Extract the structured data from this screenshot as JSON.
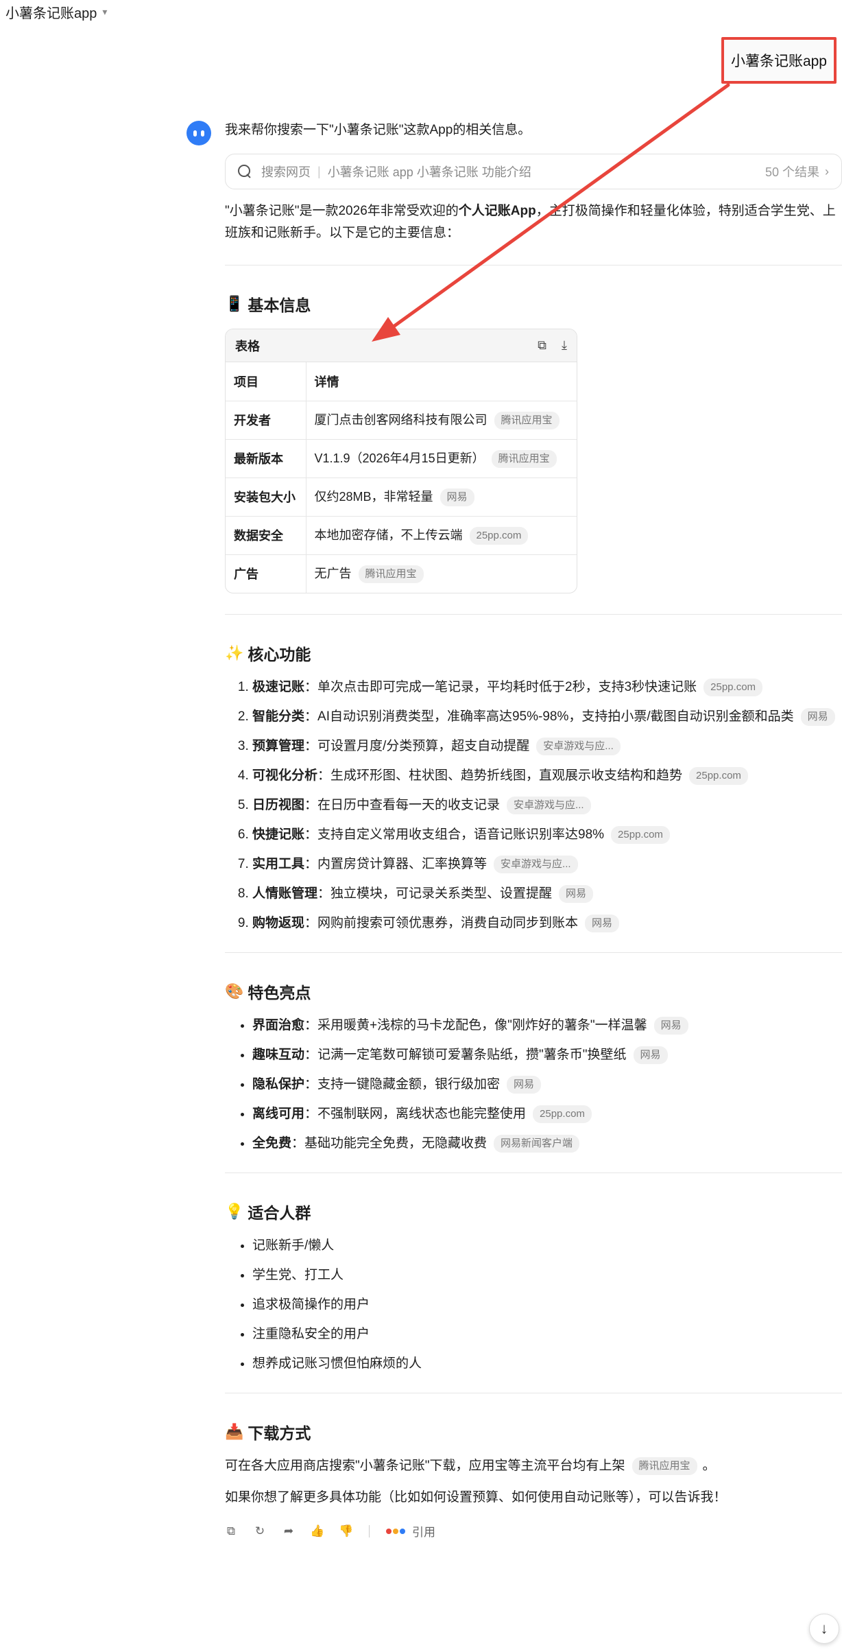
{
  "header": {
    "title": "小薯条记账app"
  },
  "user_message": "小薯条记账app",
  "bot": {
    "intro": "我来帮你搜索一下\"小薯条记账\"这款App的相关信息。",
    "search": {
      "label": "搜索网页",
      "query": "小薯条记账 app 小薯条记账 功能介绍",
      "count": "50 个结果"
    },
    "summary_prefix": "\"小薯条记账\"是一款2026年非常受欢迎的",
    "summary_bold": "个人记账App",
    "summary_suffix": "，主打极简操作和轻量化体验，特别适合学生党、上班族和记账新手。以下是它的主要信息："
  },
  "basic": {
    "icon": "📱",
    "heading": "基本信息",
    "table_label": "表格",
    "col1": "项目",
    "col2": "详情",
    "rows": [
      {
        "k": "开发者",
        "v": "厦门点击创客网络科技有限公司",
        "src": "腾讯应用宝"
      },
      {
        "k": "最新版本",
        "v": "V1.1.9（2026年4月15日更新）",
        "src": "腾讯应用宝"
      },
      {
        "k": "安装包大小",
        "v": "仅约28MB，非常轻量",
        "src": "网易"
      },
      {
        "k": "数据安全",
        "v": "本地加密存储，不上传云端",
        "src": "25pp.com"
      },
      {
        "k": "广告",
        "v": "无广告",
        "src": "腾讯应用宝"
      }
    ]
  },
  "core": {
    "icon": "✨",
    "heading": "核心功能",
    "items": [
      {
        "t": "极速记账",
        "d": "：单次点击即可完成一笔记录，平均耗时低于2秒，支持3秒快速记账",
        "src": "25pp.com"
      },
      {
        "t": "智能分类",
        "d": "：AI自动识别消费类型，准确率高达95%-98%，支持拍小票/截图自动识别金额和品类",
        "src": "网易"
      },
      {
        "t": "预算管理",
        "d": "：可设置月度/分类预算，超支自动提醒",
        "src": "安卓游戏与应..."
      },
      {
        "t": "可视化分析",
        "d": "：生成环形图、柱状图、趋势折线图，直观展示收支结构和趋势",
        "src": "25pp.com"
      },
      {
        "t": "日历视图",
        "d": "：在日历中查看每一天的收支记录",
        "src": "安卓游戏与应..."
      },
      {
        "t": "快捷记账",
        "d": "：支持自定义常用收支组合，语音记账识别率达98%",
        "src": "25pp.com"
      },
      {
        "t": "实用工具",
        "d": "：内置房贷计算器、汇率换算等",
        "src": "安卓游戏与应..."
      },
      {
        "t": "人情账管理",
        "d": "：独立模块，可记录关系类型、设置提醒",
        "src": "网易"
      },
      {
        "t": "购物返现",
        "d": "：网购前搜索可领优惠券，消费自动同步到账本",
        "src": "网易"
      }
    ]
  },
  "highlights": {
    "icon": "🎨",
    "heading": "特色亮点",
    "items": [
      {
        "t": "界面治愈",
        "d": "：采用暖黄+浅棕的马卡龙配色，像\"刚炸好的薯条\"一样温馨",
        "src": "网易"
      },
      {
        "t": "趣味互动",
        "d": "：记满一定笔数可解锁可爱薯条贴纸，攒\"薯条币\"换壁纸",
        "src": "网易"
      },
      {
        "t": "隐私保护",
        "d": "：支持一键隐藏金额，银行级加密",
        "src": "网易"
      },
      {
        "t": "离线可用",
        "d": "：不强制联网，离线状态也能完整使用",
        "src": "25pp.com"
      },
      {
        "t": "全免费",
        "d": "：基础功能完全免费，无隐藏收费",
        "src": "网易新闻客户端"
      }
    ]
  },
  "audience": {
    "icon": "💡",
    "heading": "适合人群",
    "items": [
      "记账新手/懒人",
      "学生党、打工人",
      "追求极简操作的用户",
      "注重隐私安全的用户",
      "想养成记账习惯但怕麻烦的人"
    ]
  },
  "download": {
    "icon": "📥",
    "heading": "下载方式",
    "text": "可在各大应用商店搜索\"小薯条记账\"下载，应用宝等主流平台均有上架",
    "src": "腾讯应用宝",
    "end": "。"
  },
  "closing": "如果你想了解更多具体功能（比如如何设置预算、如何使用自动记账等），可以告诉我！",
  "actions": {
    "cite_label": "引用"
  },
  "colors": {
    "accent_blue": "#2f7cf6",
    "annotation_red": "#e8453c"
  }
}
